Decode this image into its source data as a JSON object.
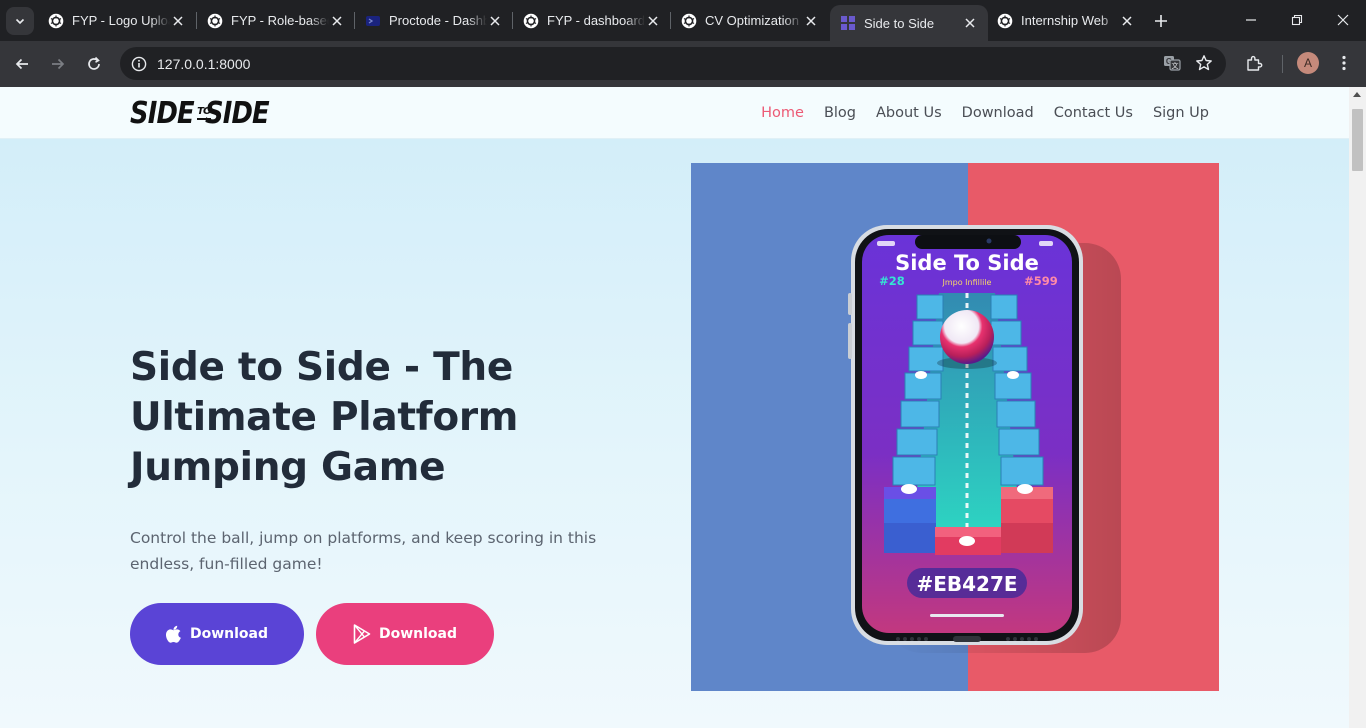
{
  "browser": {
    "tabs": [
      {
        "title": "FYP - Logo Upload",
        "favicon": "chatgpt-icon",
        "active": false
      },
      {
        "title": "FYP - Role-based",
        "favicon": "chatgpt-icon",
        "active": false
      },
      {
        "title": "Proctode - Dashboard",
        "favicon": "proctode-icon",
        "active": false
      },
      {
        "title": "FYP - dashboard",
        "favicon": "chatgpt-icon",
        "active": false
      },
      {
        "title": "CV Optimization",
        "favicon": "chatgpt-icon",
        "active": false
      },
      {
        "title": "Side to Side",
        "favicon": "site-icon",
        "active": true
      },
      {
        "title": "Internship Web",
        "favicon": "chatgpt-icon",
        "active": false
      }
    ],
    "url": "127.0.0.1:8000",
    "profile_initial": "A"
  },
  "site": {
    "logo": {
      "left": "SIDE",
      "middle": "TO",
      "right": "SIDE"
    },
    "nav": [
      {
        "label": "Home",
        "active": true
      },
      {
        "label": "Blog",
        "active": false
      },
      {
        "label": "About Us",
        "active": false
      },
      {
        "label": "Download",
        "active": false
      },
      {
        "label": "Contact Us",
        "active": false
      },
      {
        "label": "Sign Up",
        "active": false
      }
    ],
    "hero": {
      "title": "Side to Side - The Ultimate Platform Jumping Game",
      "subtitle": "Control the ball, jump on platforms, and keep scoring in this endless, fun-filled game!",
      "buttons": [
        {
          "label": "Download",
          "icon": "apple-icon",
          "color": "#5a44d6"
        },
        {
          "label": "Download",
          "icon": "google-play-icon",
          "color": "#ea3f7d"
        }
      ],
      "image": {
        "game_title": "Side To Side",
        "score_left": "#28",
        "tagline": "Jmpo Infillile",
        "score_right": "#599",
        "color_code": "#EB427E",
        "bg_left": "#5f86c9",
        "bg_right": "#e85a68"
      }
    }
  },
  "colors": {
    "accent": "#ec5a75",
    "title": "#222c3a",
    "text": "#5c6470"
  }
}
